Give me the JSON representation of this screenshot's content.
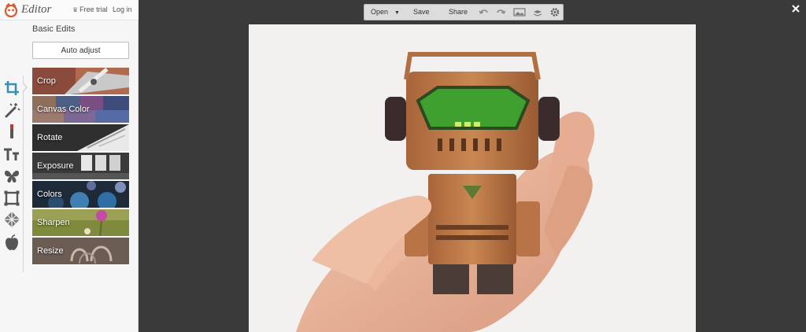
{
  "app": {
    "brand": "Editor",
    "free_trial": "Free trial",
    "login": "Log in"
  },
  "panel": {
    "title": "Basic Edits",
    "auto_adjust": "Auto adjust",
    "items": [
      {
        "label": "Crop"
      },
      {
        "label": "Canvas Color"
      },
      {
        "label": "Rotate"
      },
      {
        "label": "Exposure"
      },
      {
        "label": "Colors"
      },
      {
        "label": "Sharpen"
      },
      {
        "label": "Resize"
      }
    ]
  },
  "tools": [
    "crop-icon",
    "magic-wand-icon",
    "brush-icon",
    "text-icon",
    "butterfly-icon",
    "frame-icon",
    "texture-icon",
    "apple-icon"
  ],
  "toolbar": {
    "open": "Open",
    "save": "Save",
    "share": "Share"
  },
  "colors": {
    "accent": "#3a8fb7",
    "workspace": "#3a3a3a",
    "sidebar": "#f6f6f6"
  }
}
